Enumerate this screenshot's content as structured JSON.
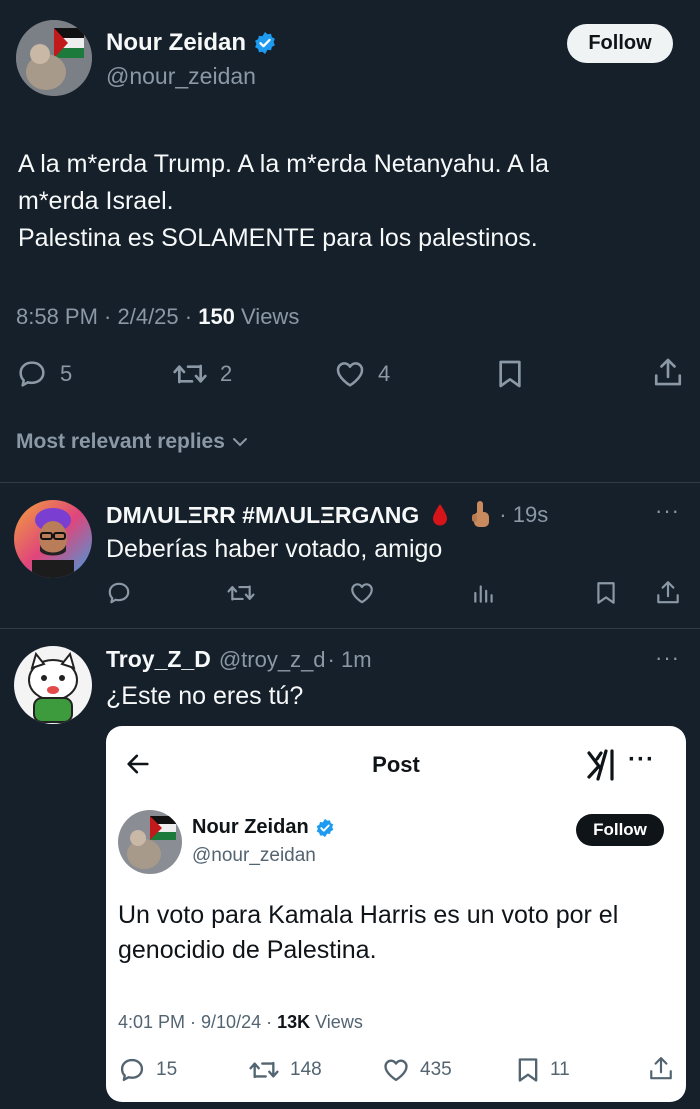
{
  "main_tweet": {
    "display_name": "Nour Zeidan",
    "handle": "@nour_zeidan",
    "follow_label": "Follow",
    "text_line1": "A la m*erda Trump. A la m*erda Netanyahu. A la",
    "text_line2": "m*erda Israel.",
    "text_line3": "Palestina es SOLAMENTE para los palestinos.",
    "time": "8:58 PM · 2/4/25 · ",
    "views_count": "150",
    "views_label": " Views",
    "replies": "5",
    "reposts": "2",
    "likes": "4"
  },
  "replies_header": "Most relevant replies",
  "reply1": {
    "display_name": "DMΛULΞRR #MΛULΞRGΛNG",
    "time": "· 19s",
    "text": "Deberías haber votado, amigo"
  },
  "reply2": {
    "display_name": "Troy_Z_D",
    "handle": "@troy_z_d",
    "time": "· 1m",
    "text": "¿Este no eres tú?"
  },
  "embedded": {
    "header_title": "Post",
    "display_name": "Nour Zeidan",
    "handle": "@nour_zeidan",
    "follow_label": "Follow",
    "text_line1": "Un voto para Kamala Harris es un voto por el",
    "text_line2": "genocidio de Palestina.",
    "time": "4:01 PM · 9/10/24 · ",
    "views_count": "13K",
    "views_label": " Views",
    "replies": "15",
    "reposts": "148",
    "likes": "435",
    "bookmarks": "11"
  },
  "colors": {
    "background": "#15202b",
    "verified": "#1d9bf0",
    "muted": "#8b98a5"
  }
}
